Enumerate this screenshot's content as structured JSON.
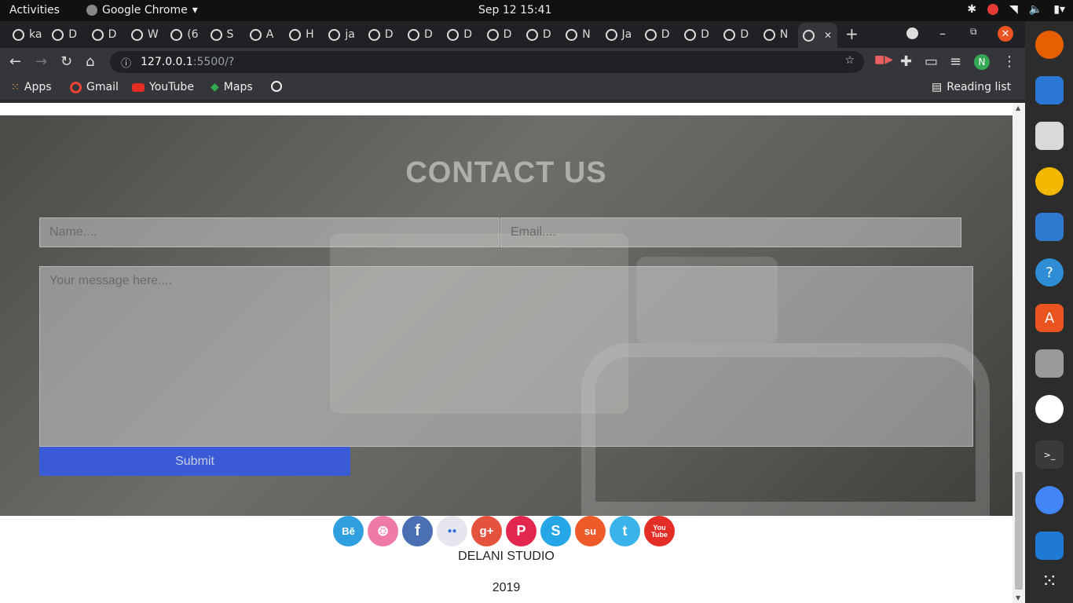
{
  "system": {
    "activities": "Activities",
    "app_name": "Google Chrome",
    "clock": "Sep 12  15:41"
  },
  "browser": {
    "tabs": [
      {
        "label": "ka"
      },
      {
        "label": "D"
      },
      {
        "label": "D"
      },
      {
        "label": "W"
      },
      {
        "label": "(6"
      },
      {
        "label": "S"
      },
      {
        "label": "A"
      },
      {
        "label": "H"
      },
      {
        "label": "ja"
      },
      {
        "label": "D"
      },
      {
        "label": "D"
      },
      {
        "label": "D"
      },
      {
        "label": "D"
      },
      {
        "label": "D"
      },
      {
        "label": "N"
      },
      {
        "label": "Ja"
      },
      {
        "label": "D"
      },
      {
        "label": "D"
      },
      {
        "label": "D"
      },
      {
        "label": "N"
      },
      {
        "label": ""
      }
    ],
    "address": {
      "host": "127.0.0.1",
      "path": ":5500/?"
    },
    "profile_initial": "N",
    "bookmarks": [
      {
        "label": "Apps",
        "icon": "apps-grid-icon"
      },
      {
        "label": "Gmail",
        "icon": "gmail-icon"
      },
      {
        "label": "YouTube",
        "icon": "youtube-icon"
      },
      {
        "label": "Maps",
        "icon": "maps-icon"
      },
      {
        "label": "",
        "icon": "globe-icon"
      }
    ],
    "reading_list": "Reading list"
  },
  "page": {
    "contact_title": "CONTACT US",
    "name_placeholder": "Name....",
    "email_placeholder": "Email....",
    "message_placeholder": "Your message here....",
    "submit_label": "Submit",
    "social": [
      {
        "icon": "behance-icon",
        "glyph": "Bē",
        "color": "#2f9fe0"
      },
      {
        "icon": "dribbble-icon",
        "glyph": "⊛",
        "color": "#ef7aa8"
      },
      {
        "icon": "facebook-icon",
        "glyph": "f",
        "color": "#4a6fb3"
      },
      {
        "icon": "flickr-icon",
        "glyph": "●●",
        "color": "#e6e6ee"
      },
      {
        "icon": "google-plus-icon",
        "glyph": "g+",
        "color": "#e5533e"
      },
      {
        "icon": "pinterest-icon",
        "glyph": "P",
        "color": "#e3264e"
      },
      {
        "icon": "skype-icon",
        "glyph": "S",
        "color": "#25a6e6"
      },
      {
        "icon": "stumbleupon-icon",
        "glyph": "su",
        "color": "#ef5a2a"
      },
      {
        "icon": "twitter-icon",
        "glyph": "t",
        "color": "#3ab3ea"
      },
      {
        "icon": "youtube-icon",
        "glyph": "You Tube",
        "color": "#e52d27"
      }
    ],
    "footer_name": "DELANI STUDIO",
    "footer_year": "2019"
  },
  "dock": [
    {
      "icon": "firefox-icon",
      "color": "#e66000"
    },
    {
      "icon": "thunderbird-icon",
      "color": "#2a77d6"
    },
    {
      "icon": "files-icon",
      "color": "#d9d9d9"
    },
    {
      "icon": "rhythmbox-icon",
      "color": "#f5b800"
    },
    {
      "icon": "libreoffice-writer-icon",
      "color": "#2f79d0"
    },
    {
      "icon": "help-icon",
      "color": "#2f8dd6"
    },
    {
      "icon": "software-center-icon",
      "color": "#e95420"
    },
    {
      "icon": "image-viewer-icon",
      "color": "#9a9a9a"
    },
    {
      "icon": "slack-icon",
      "color": "#ffffff"
    },
    {
      "icon": "terminal-icon",
      "color": "#3a3a3a"
    },
    {
      "icon": "chrome-icon",
      "color": "#4285f4"
    },
    {
      "icon": "vscode-icon",
      "color": "#1f7ad6"
    },
    {
      "icon": "show-apps-icon",
      "color": "#2c2c2c"
    }
  ]
}
